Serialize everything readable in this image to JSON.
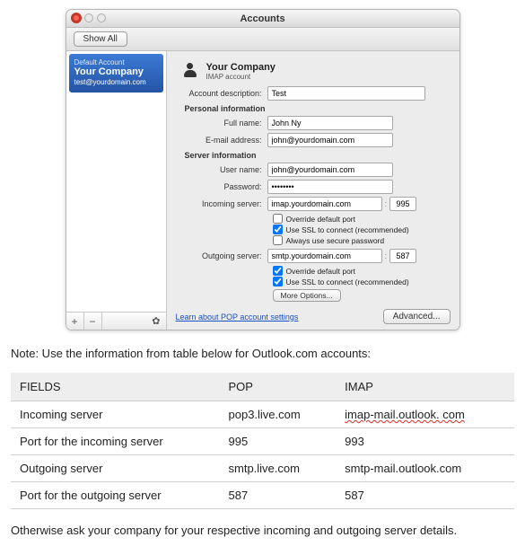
{
  "window": {
    "title": "Accounts",
    "show_all": "Show All",
    "sidebar": {
      "default_label": "Default Account",
      "account_name": "Your Company",
      "account_email": "test@yourdomain.com",
      "plus": "+",
      "minus": "−",
      "gear": "✿"
    },
    "form": {
      "header_name": "Your Company",
      "header_type": "IMAP account",
      "labels": {
        "desc": "Account description:",
        "personal": "Personal information",
        "full_name": "Full name:",
        "email": "E-mail address:",
        "server_info": "Server information",
        "user": "User name:",
        "pass": "Password:",
        "incoming": "Incoming server:",
        "outgoing": "Outgoing server:"
      },
      "values": {
        "desc": "Test",
        "full_name": "John Ny",
        "email": "john@yourdomain.com",
        "user": "john@yourdomain.com",
        "pass": "••••••••",
        "incoming": "imap.yourdomain.com",
        "incoming_port": "995",
        "outgoing": "smtp.yourdomain.com",
        "outgoing_port": "587"
      },
      "checks": {
        "in_override": "Override default port",
        "in_ssl": "Use SSL to connect (recommended)",
        "in_secure": "Always use secure password",
        "out_override": "Override default port",
        "out_ssl": "Use SSL to connect (recommended)"
      },
      "more_options": "More Options...",
      "learn_link": "Learn about POP account settings",
      "advanced": "Advanced..."
    }
  },
  "note": "Note:  Use the information from table below for Outlook.com accounts:",
  "table": {
    "headers": {
      "fields": "FIELDS",
      "pop": "POP",
      "imap": "IMAP"
    },
    "rows": [
      {
        "f": "Incoming server",
        "p": "pop3.live.com",
        "i": "imap-mail.outlook. com",
        "i_squiggle": true
      },
      {
        "f": "Port for the incoming server",
        "p": "995",
        "i": "993"
      },
      {
        "f": "Outgoing server",
        "p": "smtp.live.com",
        "i": "smtp-mail.outlook.com"
      },
      {
        "f": "Port for the outgoing server",
        "p": "587",
        "i": "587"
      }
    ]
  },
  "footnote": "Otherwise ask your company for your respective incoming and outgoing server details."
}
